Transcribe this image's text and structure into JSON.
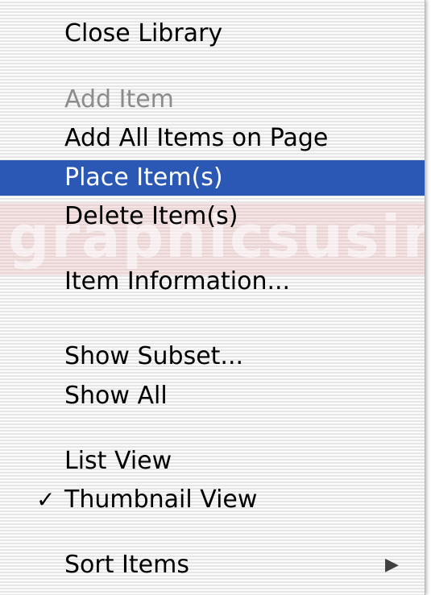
{
  "menu": {
    "watermark_text": "graphicsusing",
    "items": {
      "close_library": "Close Library",
      "add_item": "Add Item",
      "add_all_items": "Add All Items on Page",
      "place_items": "Place Item(s)",
      "delete_items": "Delete Item(s)",
      "item_information": "Item Information...",
      "show_subset": "Show Subset...",
      "show_all": "Show All",
      "list_view": "List View",
      "thumbnail_view": "Thumbnail View",
      "sort_items": "Sort Items"
    },
    "checkmark": "✓",
    "submenu_arrow": "▶",
    "selected_item": "Place Item(s)",
    "disabled_items": [
      "Add Item"
    ],
    "checked_item": "Thumbnail View",
    "colors": {
      "highlight": "#2a58b4",
      "highlight_text": "#ffffff",
      "disabled_text": "#8c8c8c"
    }
  }
}
